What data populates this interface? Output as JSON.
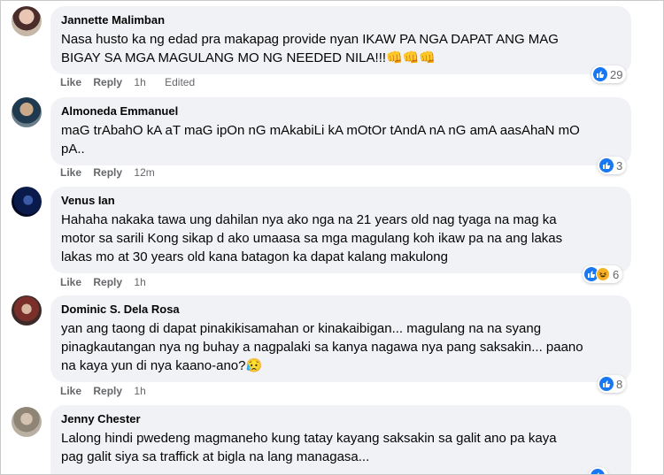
{
  "comments": [
    {
      "author": "Jannette Malimban",
      "text_lines": [
        "Nasa husto ka ng edad pra makapag provide nyan IKAW PA NGA DAPAT ANG MAG",
        "BIGAY SA MGA MAGULANG MO NG NEEDED NILA!!!👊👊👊"
      ],
      "like": "Like",
      "reply": "Reply",
      "time": "1h",
      "edited": "Edited",
      "reaction_count": "29"
    },
    {
      "author": "Almoneda Emmanuel",
      "text_lines": [
        "maG trAbahO kA aT maG ipOn nG mAkabiLi kA mOtOr tAndA nA nG amA aasAhaN mO",
        "pA.."
      ],
      "like": "Like",
      "reply": "Reply",
      "time": "12m",
      "reaction_count": "3"
    },
    {
      "author": "Venus Ian",
      "text_lines": [
        "Hahaha nakaka tawa ung dahilan nya ako nga na 21 years old nag tyaga na mag ka",
        "motor sa sarili Kong sikap d ako umaasa sa mga magulang koh ikaw pa na ang lakas",
        "lakas mo at 30 years old kana batagon ka dapat kalang makulong"
      ],
      "like": "Like",
      "reply": "Reply",
      "time": "1h",
      "reaction_count": "6"
    },
    {
      "author": "Dominic S. Dela Rosa",
      "text_lines": [
        "yan ang taong di dapat pinakikisamahan or kinakaibigan... magulang na na syang",
        "pinagkautangan nya ng buhay a nagpalaki sa kanya nagawa nya pang saksakin... paano",
        "na kaya yun di nya kaano-ano?😥"
      ],
      "like": "Like",
      "reply": "Reply",
      "time": "1h",
      "reaction_count": "8"
    },
    {
      "author": "Jenny Chester",
      "text_lines": [
        "Lalong hindi pwedeng magmaneho kung tatay kayang saksakin sa galit ano pa kaya",
        "pag galit siya sa traffick at bigla na lang managasa..."
      ]
    }
  ],
  "colors": {
    "bubble": "#f0f2f5",
    "like_blue": "#1877f2",
    "meta_gray": "#65676b",
    "haha_yellow": "#f7b125"
  }
}
